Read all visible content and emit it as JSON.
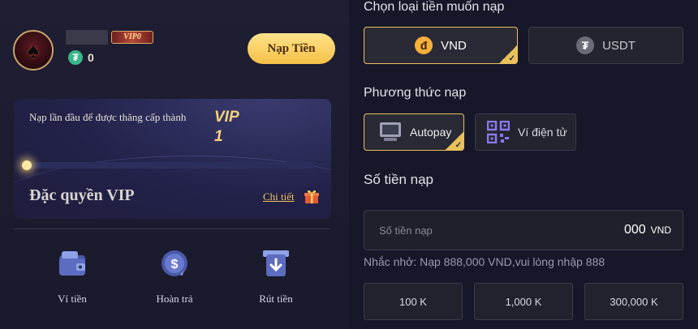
{
  "profile": {
    "vip_badge": "VIP0",
    "balance": "0",
    "deposit_button": "Nạp Tiền"
  },
  "vip_card": {
    "message": "Nạp lần đầu để được thăng cấp thành",
    "target_vip": "VIP",
    "target_level": "1",
    "privilege_title": "Đặc quyền VIP",
    "details_link": "Chi tiết",
    "progress_fraction": 0.0
  },
  "actions": [
    {
      "label": "Ví tiền",
      "icon": "wallet-icon"
    },
    {
      "label": "Hoàn trả",
      "icon": "refund-icon"
    },
    {
      "label": "Rút tiền",
      "icon": "withdraw-icon"
    }
  ],
  "deposit": {
    "currency_heading": "Chọn loại tiền muốn nạp",
    "currencies": [
      {
        "label": "VND",
        "icon": "dong-icon",
        "symbol": "đ",
        "selected": true
      },
      {
        "label": "USDT",
        "icon": "tether-icon",
        "symbol": "₮",
        "selected": false
      }
    ],
    "method_heading": "Phương thức nạp",
    "methods": [
      {
        "label": "Autopay",
        "icon": "monitor-icon",
        "selected": true
      },
      {
        "label": "Ví điện tử",
        "icon": "qr-code-icon",
        "selected": false
      }
    ],
    "amount_heading": "Số tiền nạp",
    "amount_placeholder": "Số tiền nạp",
    "amount_value": "000",
    "amount_unit": "VND",
    "reminder": "Nhắc nhở: Nạp 888,000 VND,vui lòng nhập 888",
    "presets": [
      "100 K",
      "1,000 K",
      "300,000 K"
    ]
  },
  "colors": {
    "accent_gold": "#e8c15a",
    "button_yellow": "#f6c047",
    "background": "#17172a"
  }
}
